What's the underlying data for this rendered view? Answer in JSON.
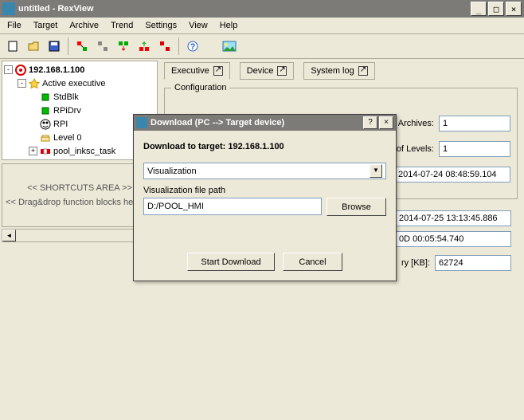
{
  "window": {
    "title": "untitled - RexView"
  },
  "menu": [
    "File",
    "Target",
    "Archive",
    "Trend",
    "Settings",
    "View",
    "Help"
  ],
  "tree": {
    "root_ip": "192.168.1.100",
    "active_exec": "Active executive",
    "items": [
      "StdBlk",
      "RPiDrv",
      "RPI",
      "Level 0",
      "pool_inksc_task"
    ]
  },
  "shortcuts": {
    "line1": "<< SHORTCUTS AREA >>",
    "line2": "<< Drag&drop function blocks here >>"
  },
  "tabs": {
    "executive": "Executive",
    "device": "Device",
    "systemlog": "System log"
  },
  "config": {
    "legend": "Configuration",
    "archives_label": "No. of Archives:",
    "archives_val": "1",
    "levels_label": "No. of Levels:",
    "levels_val": "1",
    "ts1": "2014-07-24 08:48:59.104",
    "ts2": "2014-07-25 13:13:45.886",
    "uptime": "0D 00:05:54.740",
    "mem_label": "ry [KB]:",
    "mem_val": "62724"
  },
  "dialog": {
    "title": "Download (PC --> Target device)",
    "heading_prefix": "Download to target: ",
    "heading_ip": "192.168.1.100",
    "select_value": "Visualization",
    "path_label": "Visualization file path",
    "path_value": "D:/POOL_HMI",
    "browse": "Browse",
    "start": "Start Download",
    "cancel": "Cancel"
  }
}
